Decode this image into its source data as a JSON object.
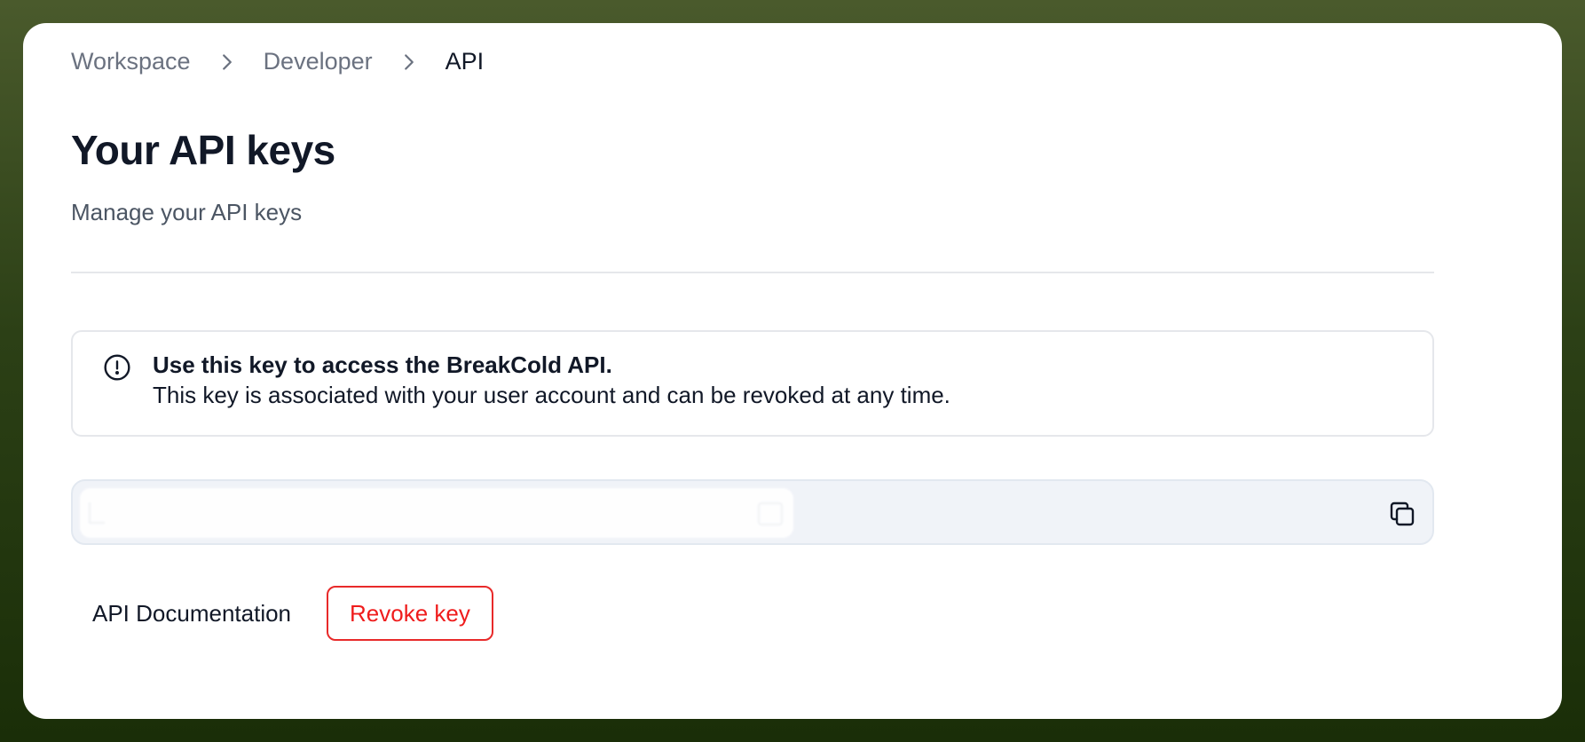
{
  "breadcrumb": {
    "items": [
      "Workspace",
      "Developer",
      "API"
    ]
  },
  "header": {
    "title": "Your API keys",
    "subtitle": "Manage your API keys"
  },
  "notice": {
    "icon": "alert-circle-icon",
    "title": "Use this key to access the BreakCold API.",
    "body": "This key is associated with your user account and can be revoked at any time."
  },
  "api_key": {
    "value": "",
    "copy_icon": "copy-icon"
  },
  "actions": {
    "documentation_label": "API Documentation",
    "revoke_label": "Revoke key"
  },
  "colors": {
    "background_top": "#4a5a2c",
    "background_bottom": "#1a2e08",
    "text_primary": "#111827",
    "text_muted": "#6b7280",
    "danger": "#ef1c1c",
    "field_bg": "#f0f3f8"
  }
}
